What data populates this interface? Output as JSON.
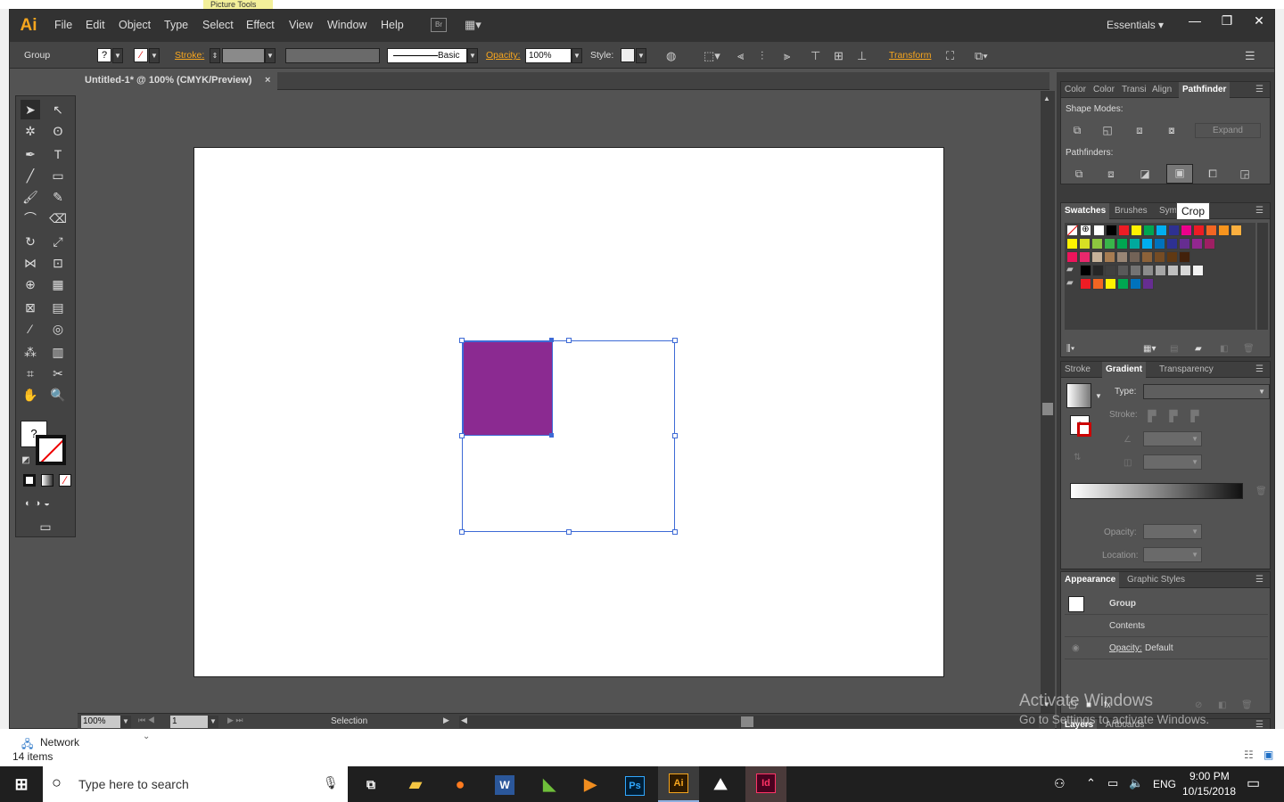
{
  "picture_tools": "Picture Tools",
  "app": {
    "logo": "Ai",
    "workspace": "Essentials"
  },
  "menu": [
    "File",
    "Edit",
    "Object",
    "Type",
    "Select",
    "Effect",
    "View",
    "Window",
    "Help"
  ],
  "bridge_label": "Br",
  "window_controls": [
    "—",
    "❐",
    "✕"
  ],
  "control_bar": {
    "selection_label": "Group",
    "stroke_label": "Stroke:",
    "brush_label": "Basic",
    "opacity_label": "Opacity:",
    "opacity_value": "100%",
    "style_label": "Style:",
    "transform_label": "Transform"
  },
  "document_tab": {
    "title": "Untitled-1* @ 100% (CMYK/Preview)",
    "close": "×"
  },
  "status": {
    "zoom": "100%",
    "artboard": "1",
    "tool": "Selection"
  },
  "panel_group1": {
    "tabs": [
      "Color",
      "Color",
      "Transi",
      "Align",
      "Pathfinder"
    ],
    "shape_modes": "Shape Modes:",
    "expand": "Expand",
    "pathfinders": "Pathfinders:"
  },
  "tooltip": "Crop",
  "swatches_tabs": [
    "Swatches",
    "Brushes",
    "Sym"
  ],
  "colors": {
    "selected_rect": "#8b2a91",
    "accent": "#f7a61e",
    "swatch_rows": [
      [
        "#ffffff",
        "#000000",
        "#ed1c24",
        "#fff200",
        "#00a651",
        "#00aeef",
        "#2e3192",
        "#ec008c",
        "#ed1c24",
        "#f26522",
        "#f7941d",
        "#fbaf3f"
      ],
      [
        "#fff200",
        "#d7df23",
        "#8dc63f",
        "#39b54a",
        "#00a651",
        "#00a99d",
        "#00aeef",
        "#0072bc",
        "#2e3192",
        "#662d91",
        "#92278f",
        "#9e1f63"
      ],
      [
        "#ed145b",
        "#e8286c",
        "#c7b299",
        "#a67c52",
        "#998675",
        "#736357",
        "#8c6239",
        "#754c24",
        "#603913",
        "#42210b"
      ],
      [
        "#000000",
        "#262626",
        "#404040",
        "#595959",
        "#737373",
        "#8c8c8c",
        "#a6a6a6",
        "#bfbfbf",
        "#d9d9d9",
        "#f2f2f2"
      ],
      [
        "#ed1c24",
        "#f26522",
        "#fff200",
        "#00a651",
        "#0072bc",
        "#662d91"
      ]
    ]
  },
  "gradient_panel": {
    "tabs": [
      "Stroke",
      "Gradient",
      "Transparency"
    ],
    "type_label": "Type:",
    "stroke_label": "Stroke:",
    "opacity_label": "Opacity:",
    "location_label": "Location:"
  },
  "appearance_panel": {
    "tabs": [
      "Appearance",
      "Graphic Styles"
    ],
    "rows": [
      "Group",
      "Contents"
    ],
    "opacity_label": "Opacity:",
    "opacity_value": "Default"
  },
  "layers_tabs": [
    "Layers",
    "Artboards"
  ],
  "watermark": {
    "line1": "Activate Windows",
    "line2": "Go to Settings to activate Windows."
  },
  "explorer": {
    "network": "Network",
    "items": "14 items"
  },
  "taskbar": {
    "search_placeholder": "Type here to search",
    "lang": "ENG",
    "time": "9:00 PM",
    "date": "10/15/2018",
    "apps": [
      "W",
      "Ps",
      "Ai",
      "Id"
    ]
  }
}
